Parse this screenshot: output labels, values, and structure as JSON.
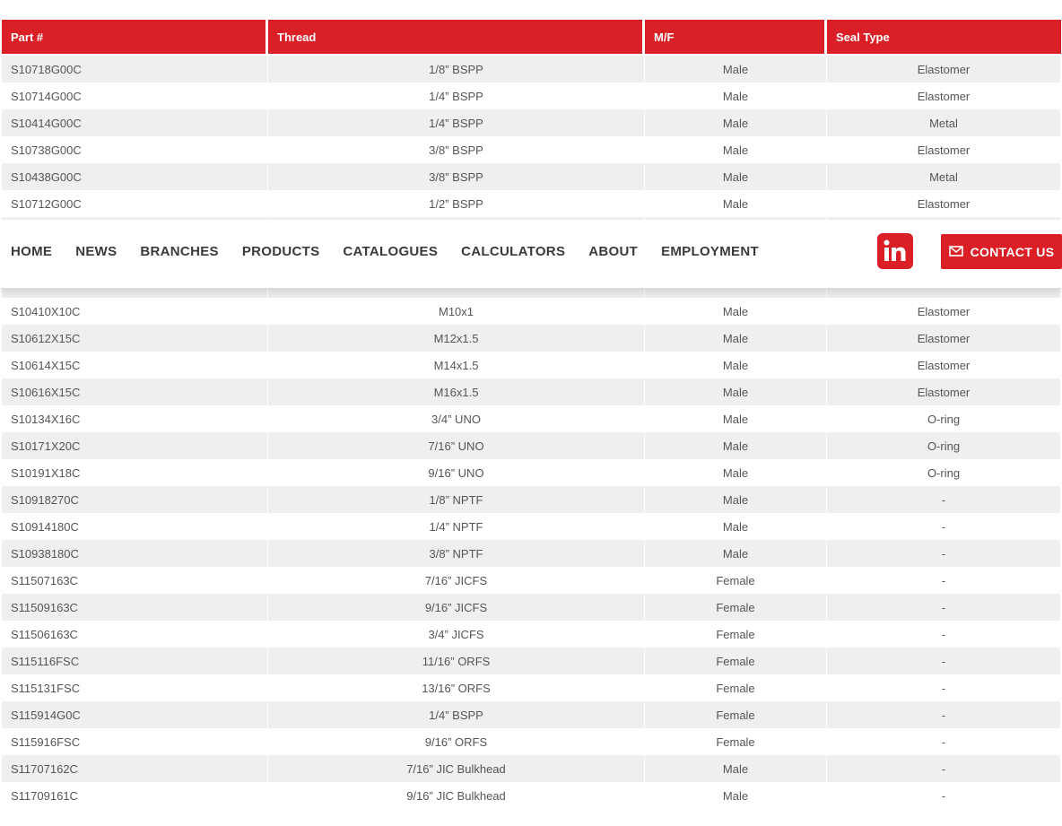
{
  "table": {
    "headers": [
      "Part #",
      "Thread",
      "M/F",
      "Seal Type"
    ],
    "rows": [
      [
        "S10718G00C",
        "1/8” BSPP",
        "Male",
        "Elastomer"
      ],
      [
        "S10714G00C",
        "1/4” BSPP",
        "Male",
        "Elastomer"
      ],
      [
        "S10414G00C",
        "1/4” BSPP",
        "Male",
        "Metal"
      ],
      [
        "S10738G00C",
        "3/8” BSPP",
        "Male",
        "Elastomer"
      ],
      [
        "S10438G00C",
        "3/8” BSPP",
        "Male",
        "Metal"
      ],
      [
        "S10712G00C",
        "1/2” BSPP",
        "Male",
        "Elastomer"
      ],
      [
        "",
        "",
        "",
        ""
      ],
      [
        "",
        "",
        "",
        ""
      ],
      [
        "",
        "",
        "",
        ""
      ],
      [
        "S10410X10C",
        "M10x1",
        "Male",
        "Elastomer"
      ],
      [
        "S10612X15C",
        "M12x1.5",
        "Male",
        "Elastomer"
      ],
      [
        "S10614X15C",
        "M14x1.5",
        "Male",
        "Elastomer"
      ],
      [
        "S10616X15C",
        "M16x1.5",
        "Male",
        "Elastomer"
      ],
      [
        "S10134X16C",
        "3/4” UNO",
        "Male",
        "O-ring"
      ],
      [
        "S10171X20C",
        "7/16” UNO",
        "Male",
        "O-ring"
      ],
      [
        "S10191X18C",
        "9/16” UNO",
        "Male",
        "O-ring"
      ],
      [
        "S10918270C",
        "1/8” NPTF",
        "Male",
        "-"
      ],
      [
        "S10914180C",
        "1/4” NPTF",
        "Male",
        "-"
      ],
      [
        "S10938180C",
        "3/8” NPTF",
        "Male",
        "-"
      ],
      [
        "S11507163C",
        "7/16” JICFS",
        "Female",
        "-"
      ],
      [
        "S11509163C",
        "9/16” JICFS",
        "Female",
        "-"
      ],
      [
        "S11506163C",
        "3/4” JICFS",
        "Female",
        "-"
      ],
      [
        "S115116FSC",
        "11/16” ORFS",
        "Female",
        "-"
      ],
      [
        "S115131FSC",
        "13/16” ORFS",
        "Female",
        "-"
      ],
      [
        "S115914G0C",
        "1/4” BSPP",
        "Female",
        "-"
      ],
      [
        "S115916FSC",
        "9/16” ORFS",
        "Female",
        "-"
      ],
      [
        "S11707162C",
        "7/16” JIC Bulkhead",
        "Male",
        "-"
      ],
      [
        "S11709161C",
        "9/16” JIC Bulkhead",
        "Male",
        "-"
      ]
    ]
  },
  "nav": {
    "items": [
      "HOME",
      "NEWS",
      "BRANCHES",
      "PRODUCTS",
      "CATALOGUES",
      "CALCULATORS",
      "ABOUT",
      "EMPLOYMENT"
    ],
    "linkedin_icon": "linkedin-icon",
    "contact_label": "CONTACT US",
    "contact_icon": "envelope-icon"
  },
  "colors": {
    "accent": "#db1f26",
    "row_alt": "#efefef"
  }
}
